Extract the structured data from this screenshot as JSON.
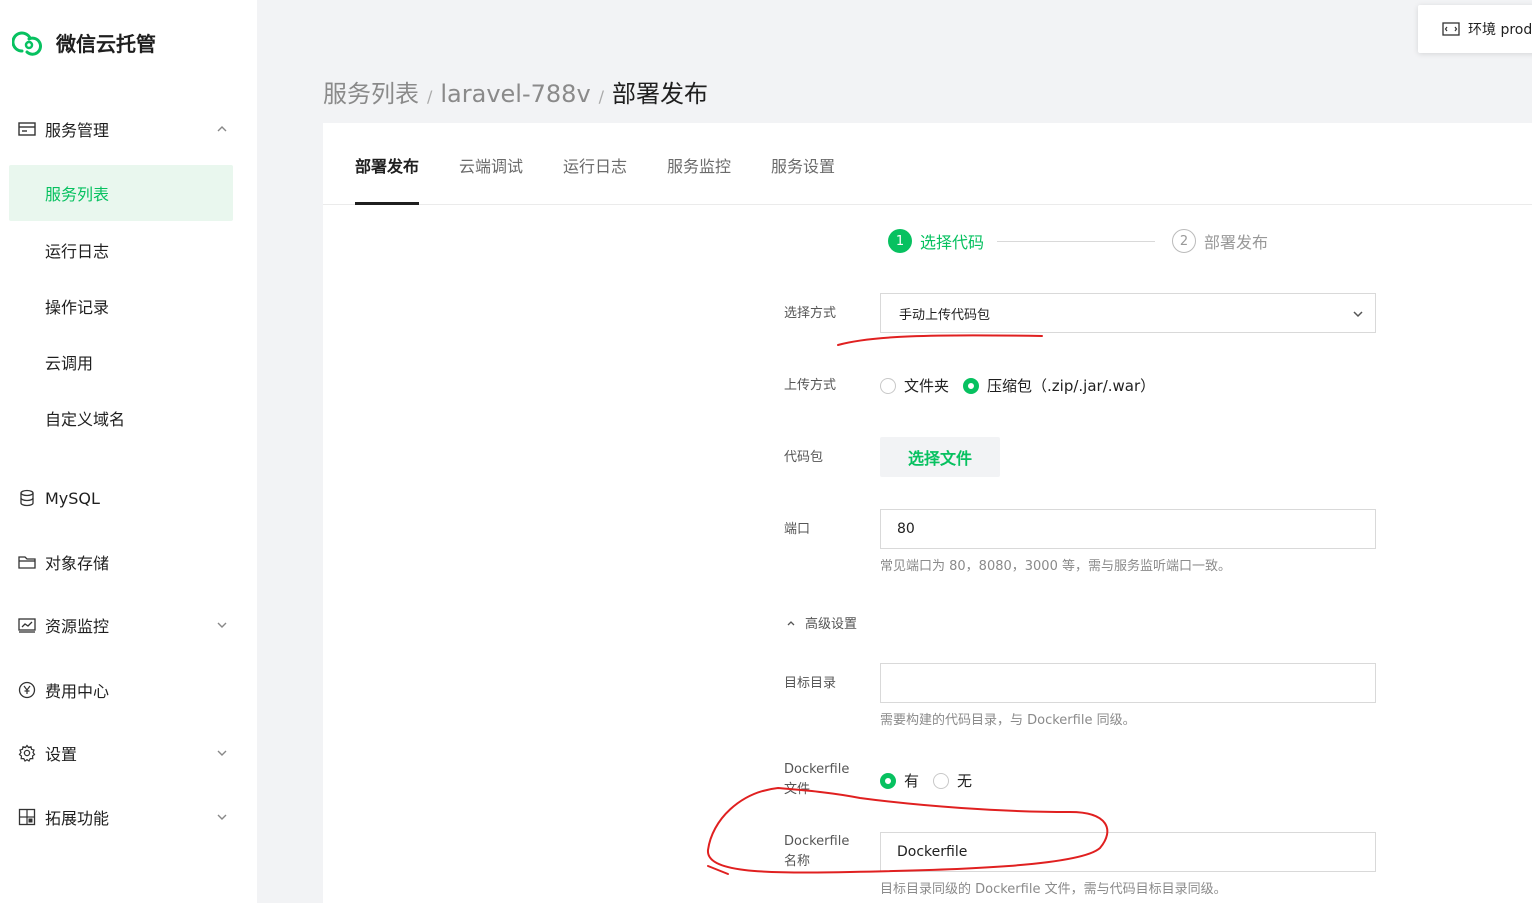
{
  "app": {
    "title": "微信云托管"
  },
  "sidebar": {
    "groups": [
      {
        "label": "服务管理",
        "icon": "server-icon"
      },
      {
        "label": "MySQL",
        "icon": "database-icon"
      },
      {
        "label": "对象存储",
        "icon": "folder-icon"
      },
      {
        "label": "资源监控",
        "icon": "monitor-icon"
      },
      {
        "label": "费用中心",
        "icon": "yen-icon"
      },
      {
        "label": "设置",
        "icon": "gear-icon"
      },
      {
        "label": "拓展功能",
        "icon": "extension-icon"
      }
    ],
    "items": [
      {
        "label": "服务列表"
      },
      {
        "label": "运行日志"
      },
      {
        "label": "操作记录"
      },
      {
        "label": "云调用"
      },
      {
        "label": "自定义域名"
      }
    ],
    "active_item": "服务列表"
  },
  "env": {
    "label": "环境 prod"
  },
  "breadcrumb": {
    "items": [
      "服务列表",
      "laravel-788v",
      "部署发布"
    ],
    "separator": "/"
  },
  "tabs": [
    {
      "label": "部署发布"
    },
    {
      "label": "云端调试"
    },
    {
      "label": "运行日志"
    },
    {
      "label": "服务监控"
    },
    {
      "label": "服务设置"
    }
  ],
  "steps": [
    {
      "num": "1",
      "label": "选择代码"
    },
    {
      "num": "2",
      "label": "部署发布"
    }
  ],
  "form": {
    "method_label": "选择方式",
    "method_value": "手动上传代码包",
    "upload_label": "上传方式",
    "upload_opt_folder": "文件夹",
    "upload_opt_zip": "压缩包（.zip/.jar/.war）",
    "package_label": "代码包",
    "choose_file": "选择文件",
    "port_label": "端口",
    "port_value": "80",
    "port_hint": "常见端口为 80，8080，3000 等，需与服务监听端口一致。",
    "advanced_label": "高级设置",
    "target_dir_label": "目标目录",
    "target_dir_value": "",
    "target_dir_hint": "需要构建的代码目录，与 Dockerfile 同级。",
    "dockerfile_label_1": "Dockerfile",
    "dockerfile_label_2": "文件",
    "dockerfile_yes": "有",
    "dockerfile_no": "无",
    "dockerfile_name_label_1": "Dockerfile",
    "dockerfile_name_label_2": "名称",
    "dockerfile_name_value": "Dockerfile",
    "dockerfile_name_hint": "目标目录同级的 Dockerfile 文件，需与代码目标目录同级。"
  },
  "colors": {
    "accent": "#07c160",
    "annotation": "#e02020"
  }
}
